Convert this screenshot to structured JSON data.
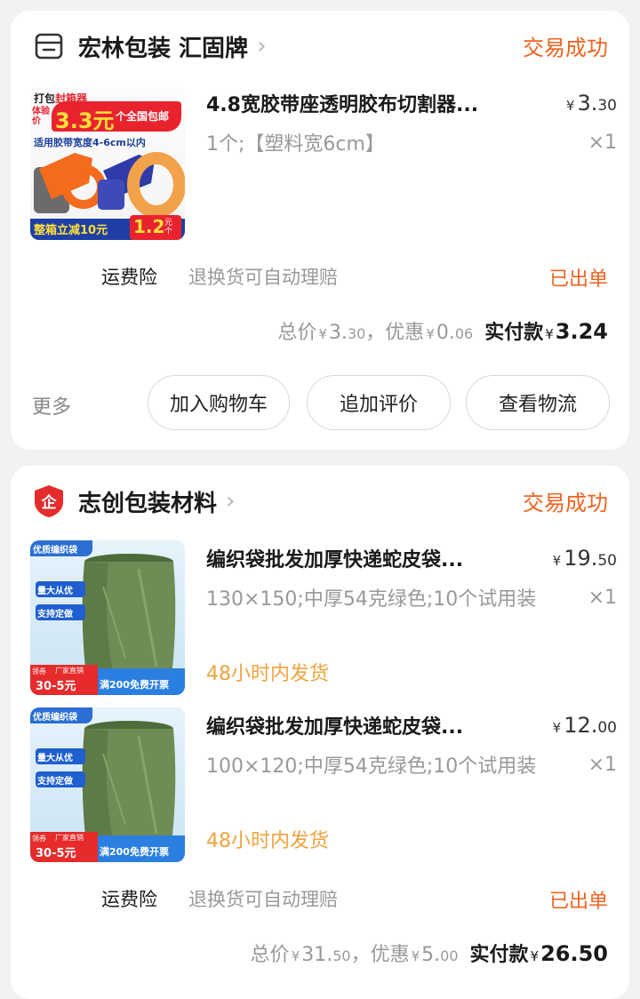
{
  "orders": [
    {
      "shop_name": "宏林包装 汇固牌",
      "shop_icon": "store-icon",
      "status": "交易成功",
      "items": [
        {
          "title": "4.8宽胶带座透明胶布切割器...",
          "price_yen": "¥",
          "price_int": "3.",
          "price_dec": "30",
          "spec": "1个;【塑料宽6cm】",
          "qty": "×1",
          "thumb": {
            "line1a": "打包",
            "line1b": "封箱器",
            "badge_big": "3.3元",
            "badge_side": "个全国包邮",
            "prefix": "体验价",
            "line3": "适用胶带宽度4-6cm以内",
            "bottom": "整箱立减10元",
            "bottom_price": "1.2",
            "bottom_unit": "元个"
          }
        }
      ],
      "insurance_label": "运费险",
      "insurance_desc": "退换货可自动理赔",
      "order_state": "已出单",
      "totals": {
        "total_label": "总价",
        "total_int": "3.",
        "total_dec": "30",
        "discount_label": "，优惠",
        "discount_int": "0.",
        "discount_dec": "06",
        "paid_label": "实付款",
        "paid_value": "3.24",
        "currency": "¥"
      },
      "more": "更多",
      "buttons": [
        "加入购物车",
        "追加评价",
        "查看物流"
      ]
    },
    {
      "shop_name": "志创包装材料",
      "shop_icon": "enterprise-shield-icon",
      "shop_icon_char": "企",
      "status": "交易成功",
      "items": [
        {
          "title": "编织袋批发加厚快递蛇皮袋...",
          "price_yen": "¥",
          "price_int": "19.",
          "price_dec": "50",
          "spec": "130×150;中厚54克绿色;10个试用装",
          "qty": "×1",
          "shipping": "48小时内发货",
          "thumb": {
            "tag": "优质编织袋",
            "badge1": "量大从优",
            "badge2": "支持定做",
            "coupon_a": "领券",
            "coupon_b": "30-5元",
            "coupon_c": "厂家直销",
            "bottom": "满200免费开票"
          }
        },
        {
          "title": "编织袋批发加厚快递蛇皮袋...",
          "price_yen": "¥",
          "price_int": "12.",
          "price_dec": "00",
          "spec": "100×120;中厚54克绿色;10个试用装",
          "qty": "×1",
          "shipping": "48小时内发货",
          "thumb": {
            "tag": "优质编织袋",
            "badge1": "量大从优",
            "badge2": "支持定做",
            "coupon_a": "领券",
            "coupon_b": "30-5元",
            "coupon_c": "厂家直销",
            "bottom": "满200免费开票"
          }
        }
      ],
      "insurance_label": "运费险",
      "insurance_desc": "退换货可自动理赔",
      "order_state": "已出单",
      "totals": {
        "total_label": "总价",
        "total_int": "31.",
        "total_dec": "50",
        "discount_label": "，优惠",
        "discount_int": "5.",
        "discount_dec": "00",
        "paid_label": "实付款",
        "paid_value": "26.50",
        "currency": "¥"
      }
    }
  ],
  "colors": {
    "accent_orange": "#f0631f",
    "shipping_orange": "#f0a33e",
    "text_gray": "#999999"
  }
}
